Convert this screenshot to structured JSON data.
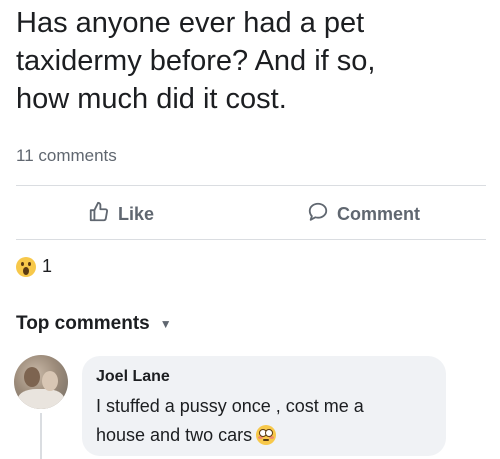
{
  "post": {
    "line1": "Has anyone ever had a pet",
    "line2": "taxidermy before? And if so,",
    "line3": "how much did it cost."
  },
  "stats": {
    "comments_count": "11 comments"
  },
  "actions": {
    "like_label": "Like",
    "comment_label": "Comment"
  },
  "reactions": {
    "icon": "wow-emoji",
    "count": "1"
  },
  "comments_section": {
    "header": "Top comments",
    "items": [
      {
        "author": "Joel Lane",
        "text_line1": "I stuffed a pussy once , cost me a",
        "text_line2": "house and two cars",
        "emoji": "flushed-face-emoji"
      }
    ]
  },
  "colors": {
    "text": "#1c1e21",
    "muted": "#606770",
    "bubble": "#f0f2f5",
    "divider": "#dadde1"
  }
}
